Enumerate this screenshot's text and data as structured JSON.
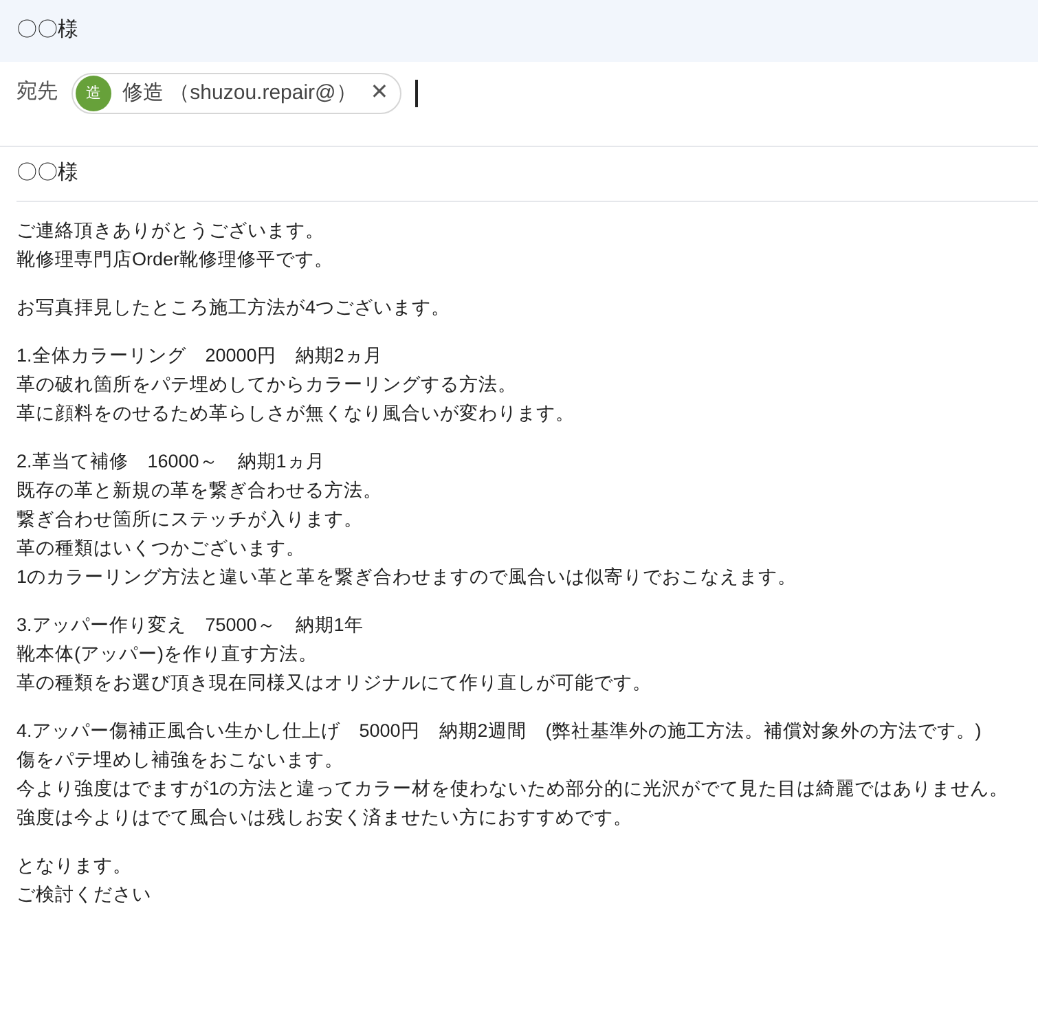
{
  "window": {
    "title": "〇〇様"
  },
  "recipients": {
    "label": "宛先",
    "chips": [
      {
        "avatar": "造",
        "text": "修造 （shuzou.repair@）",
        "close": "✕",
        "color": "#67a13a"
      }
    ]
  },
  "subject": "〇〇様",
  "body": [
    {
      "lines": [
        "ご連絡頂きありがとうございます。",
        "靴修理専門店Order靴修理修平です。"
      ]
    },
    {
      "lines": [
        "お写真拝見したところ施工方法が4つございます。"
      ]
    },
    {
      "lines": [
        "1.全体カラーリング　20000円　納期2ヵ月",
        "革の破れ箇所をパテ埋めしてからカラーリングする方法。",
        "革に顔料をのせるため革らしさが無くなり風合いが変わります。"
      ]
    },
    {
      "lines": [
        "2.革当て補修　16000～　納期1ヵ月",
        "既存の革と新規の革を繋ぎ合わせる方法。",
        "繋ぎ合わせ箇所にステッチが入ります。",
        "革の種類はいくつかございます。",
        "1のカラーリング方法と違い革と革を繋ぎ合わせますので風合いは似寄りでおこなえます。"
      ]
    },
    {
      "lines": [
        "3.アッパー作り変え　75000～　納期1年",
        "靴本体(アッパー)を作り直す方法。",
        "革の種類をお選び頂き現在同様又はオリジナルにて作り直しが可能です。"
      ]
    },
    {
      "lines": [
        "4.アッパー傷補正風合い生かし仕上げ　5000円　納期2週間　(弊社基準外の施工方法。補償対象外の方法です。)",
        "傷をパテ埋めし補強をおこないます。",
        "今より強度はでますが1の方法と違ってカラー材を使わないため部分的に光沢がでて見た目は綺麗ではありません。",
        "強度は今よりはでて風合いは残しお安く済ませたい方におすすめです。"
      ]
    },
    {
      "lines": [
        "となります。",
        "ご検討ください"
      ]
    }
  ]
}
